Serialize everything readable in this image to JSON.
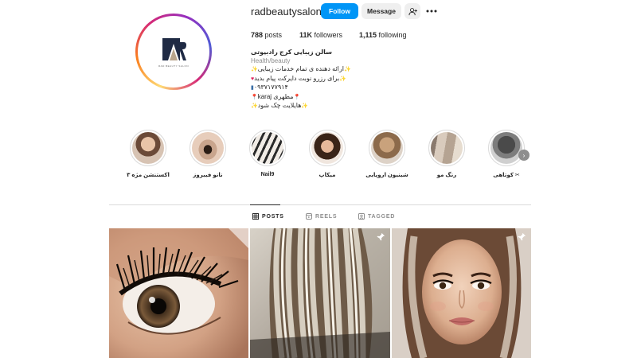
{
  "profile": {
    "username": "radbeautysalon",
    "follow_label": "Follow",
    "message_label": "Message",
    "logo_caption": "RAD BEAUTY SALON"
  },
  "stats": {
    "posts_count": "788",
    "posts_label": "posts",
    "followers_count": "11K",
    "followers_label": "followers",
    "following_count": "1,115",
    "following_label": "following"
  },
  "bio": {
    "name": "سالن زیبایی کرج رادبیوتی",
    "category": "Health/beauty",
    "lines": [
      "ارائه دهنده ی تمام خدمات زیبایی",
      "برای رزرو نوبت دایرکت پیام بدید",
      "۰۹۳۷۱۷۷۹۱۴",
      "karaj مطهری",
      "هایلایت چک شود"
    ]
  },
  "highlights": [
    {
      "label": "اکستنشن مژه ۳"
    },
    {
      "label": "نانو فیبروز"
    },
    {
      "label": "Nail9"
    },
    {
      "label": "میکاپ"
    },
    {
      "label": "شینیون اروپایی"
    },
    {
      "label": "رنگ مو"
    },
    {
      "label": "کوتاهی"
    }
  ],
  "tabs": {
    "posts": "POSTS",
    "reels": "REELS",
    "tagged": "TAGGED"
  },
  "colors": {
    "follow_blue": "#0095f6",
    "button_gray": "#efefef",
    "text": "#262626",
    "muted": "#8e8e8e",
    "border": "#dbdbdb"
  }
}
